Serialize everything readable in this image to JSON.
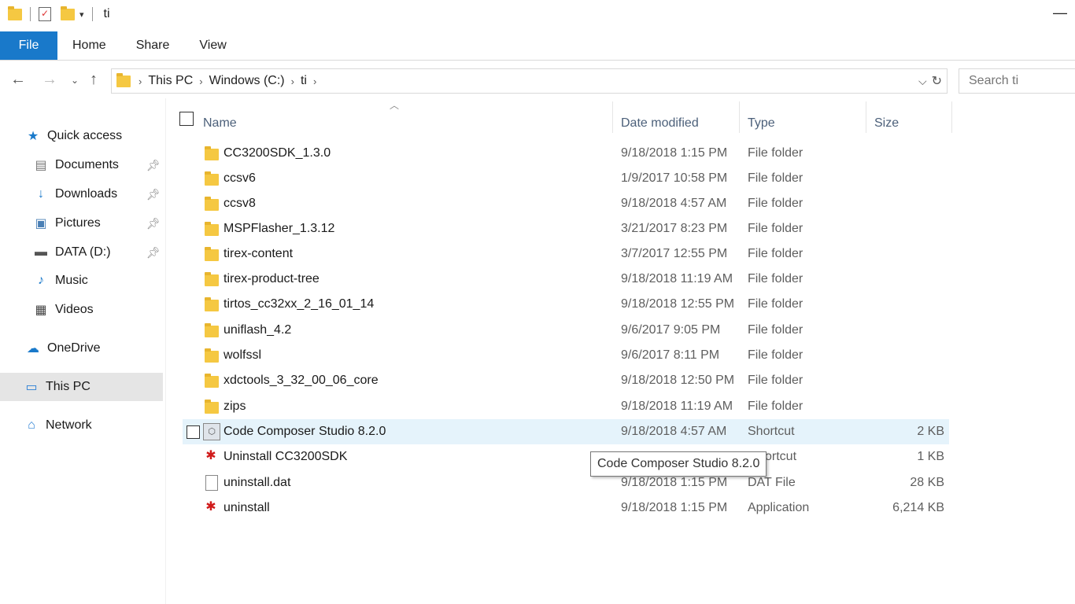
{
  "window": {
    "title": "ti"
  },
  "ribbon": {
    "tabs": [
      "File",
      "Home",
      "Share",
      "View"
    ]
  },
  "address": {
    "crumbs": [
      "This PC",
      "Windows (C:)",
      "ti"
    ]
  },
  "search": {
    "placeholder": "Search ti"
  },
  "sidebar": {
    "items": [
      {
        "label": "Quick access",
        "icon": "star-icon"
      },
      {
        "label": "Documents",
        "icon": "documents-icon",
        "pinned": true
      },
      {
        "label": "Downloads",
        "icon": "download-arrow-icon",
        "pinned": true
      },
      {
        "label": "Pictures",
        "icon": "pictures-icon",
        "pinned": true
      },
      {
        "label": "DATA (D:)",
        "icon": "drive-icon",
        "pinned": true
      },
      {
        "label": "Music",
        "icon": "music-note-icon"
      },
      {
        "label": "Videos",
        "icon": "film-icon"
      },
      {
        "label": "OneDrive",
        "icon": "cloud-icon"
      },
      {
        "label": "This PC",
        "icon": "computer-icon",
        "selected": true
      },
      {
        "label": "Network",
        "icon": "network-icon"
      }
    ]
  },
  "columns": {
    "name": "Name",
    "date": "Date modified",
    "type": "Type",
    "size": "Size"
  },
  "files": [
    {
      "name": "CC3200SDK_1.3.0",
      "date": "9/18/2018 1:15 PM",
      "type": "File folder",
      "size": ""
    },
    {
      "name": "ccsv6",
      "date": "1/9/2017 10:58 PM",
      "type": "File folder",
      "size": ""
    },
    {
      "name": "ccsv8",
      "date": "9/18/2018 4:57 AM",
      "type": "File folder",
      "size": ""
    },
    {
      "name": "MSPFlasher_1.3.12",
      "date": "3/21/2017 8:23 PM",
      "type": "File folder",
      "size": ""
    },
    {
      "name": "tirex-content",
      "date": "3/7/2017 12:55 PM",
      "type": "File folder",
      "size": ""
    },
    {
      "name": "tirex-product-tree",
      "date": "9/18/2018 11:19 AM",
      "type": "File folder",
      "size": ""
    },
    {
      "name": "tirtos_cc32xx_2_16_01_14",
      "date": "9/18/2018 12:55 PM",
      "type": "File folder",
      "size": ""
    },
    {
      "name": "uniflash_4.2",
      "date": "9/6/2017 9:05 PM",
      "type": "File folder",
      "size": ""
    },
    {
      "name": "wolfssl",
      "date": "9/6/2017 8:11 PM",
      "type": "File folder",
      "size": ""
    },
    {
      "name": "xdctools_3_32_00_06_core",
      "date": "9/18/2018 12:50 PM",
      "type": "File folder",
      "size": ""
    },
    {
      "name": "zips",
      "date": "9/18/2018 11:19 AM",
      "type": "File folder",
      "size": ""
    },
    {
      "name": "Code Composer Studio 8.2.0",
      "date": "9/18/2018 4:57 AM",
      "type": "Shortcut",
      "size": "2 KB"
    },
    {
      "name": "Uninstall CC3200SDK",
      "date": "",
      "type": "ortcut",
      "size": "1 KB"
    },
    {
      "name": "uninstall.dat",
      "date": "9/18/2018 1:15 PM",
      "type": "DAT File",
      "size": "28 KB"
    },
    {
      "name": "uninstall",
      "date": "9/18/2018 1:15 PM",
      "type": "Application",
      "size": "6,214 KB"
    }
  ],
  "tooltip": {
    "text": "Code Composer Studio 8.2.0"
  },
  "colors": {
    "accent": "#1979ca",
    "hover_row": "#e5f3fb",
    "selected_nav": "#e5e5e5",
    "folder": "#f5c842"
  }
}
